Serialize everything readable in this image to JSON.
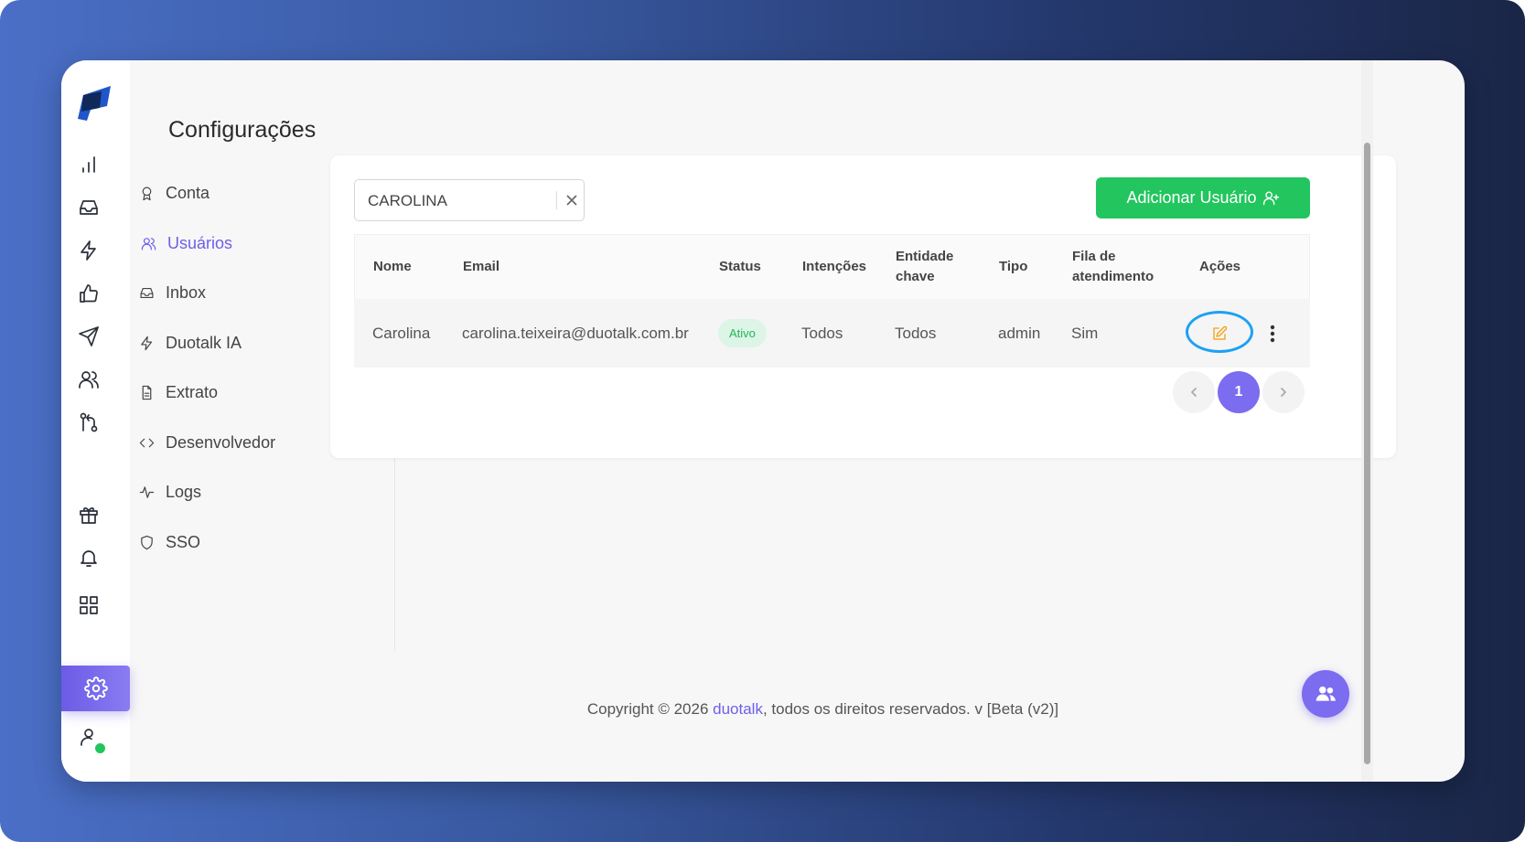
{
  "page": {
    "title": "Configurações"
  },
  "rail": {
    "items": [
      {
        "name": "dashboard",
        "icon": "bar-chart-icon"
      },
      {
        "name": "inbox",
        "icon": "inbox-icon"
      },
      {
        "name": "automations",
        "icon": "lightning-icon"
      },
      {
        "name": "feedback",
        "icon": "thumbs-up-icon"
      },
      {
        "name": "campaigns",
        "icon": "send-icon"
      },
      {
        "name": "contacts",
        "icon": "users-icon"
      },
      {
        "name": "flows",
        "icon": "git-branch-icon"
      },
      {
        "name": "gifts",
        "icon": "gift-icon"
      },
      {
        "name": "notifications",
        "icon": "bell-icon"
      },
      {
        "name": "apps",
        "icon": "grid-icon"
      },
      {
        "name": "settings",
        "icon": "gear-icon",
        "active": true
      },
      {
        "name": "profile",
        "icon": "user-icon",
        "status": "online"
      }
    ]
  },
  "submenu": {
    "items": [
      {
        "label": "Conta",
        "icon": "award-icon"
      },
      {
        "label": "Usuários",
        "icon": "users-icon",
        "active": true
      },
      {
        "label": "Inbox",
        "icon": "inbox-icon"
      },
      {
        "label": "Duotalk IA",
        "icon": "lightning-icon"
      },
      {
        "label": "Extrato",
        "icon": "file-text-icon"
      },
      {
        "label": "Desenvolvedor",
        "icon": "code-icon"
      },
      {
        "label": "Logs",
        "icon": "activity-icon"
      },
      {
        "label": "SSO",
        "icon": "shield-icon"
      }
    ]
  },
  "search": {
    "value": "CAROLINA"
  },
  "add_button": {
    "label": "Adicionar Usuário",
    "icon": "user-plus-icon"
  },
  "table": {
    "headers": {
      "nome": "Nome",
      "email": "Email",
      "status": "Status",
      "intencoes": "Intenções",
      "entidade_line1": "Entidade",
      "entidade_line2": "chave",
      "tipo": "Tipo",
      "fila_line1": "Fila de",
      "fila_line2": "atendimento",
      "acoes": "Ações"
    },
    "rows": [
      {
        "nome": "Carolina",
        "email": "carolina.teixeira@duotalk.com.br",
        "status": "Ativo",
        "intencoes": "Todos",
        "entidade": "Todos",
        "tipo": "admin",
        "fila": "Sim"
      }
    ]
  },
  "pagination": {
    "current": "1"
  },
  "footer": {
    "prefix": "Copyright © 2026 ",
    "brand": "duotalk",
    "suffix": ", todos os direitos reservados. v [Beta (v2)]"
  },
  "colors": {
    "accent": "#7b6cf0",
    "success": "#22c55e",
    "edit": "#f59e0b",
    "highlight_ring": "#1da1f2"
  }
}
